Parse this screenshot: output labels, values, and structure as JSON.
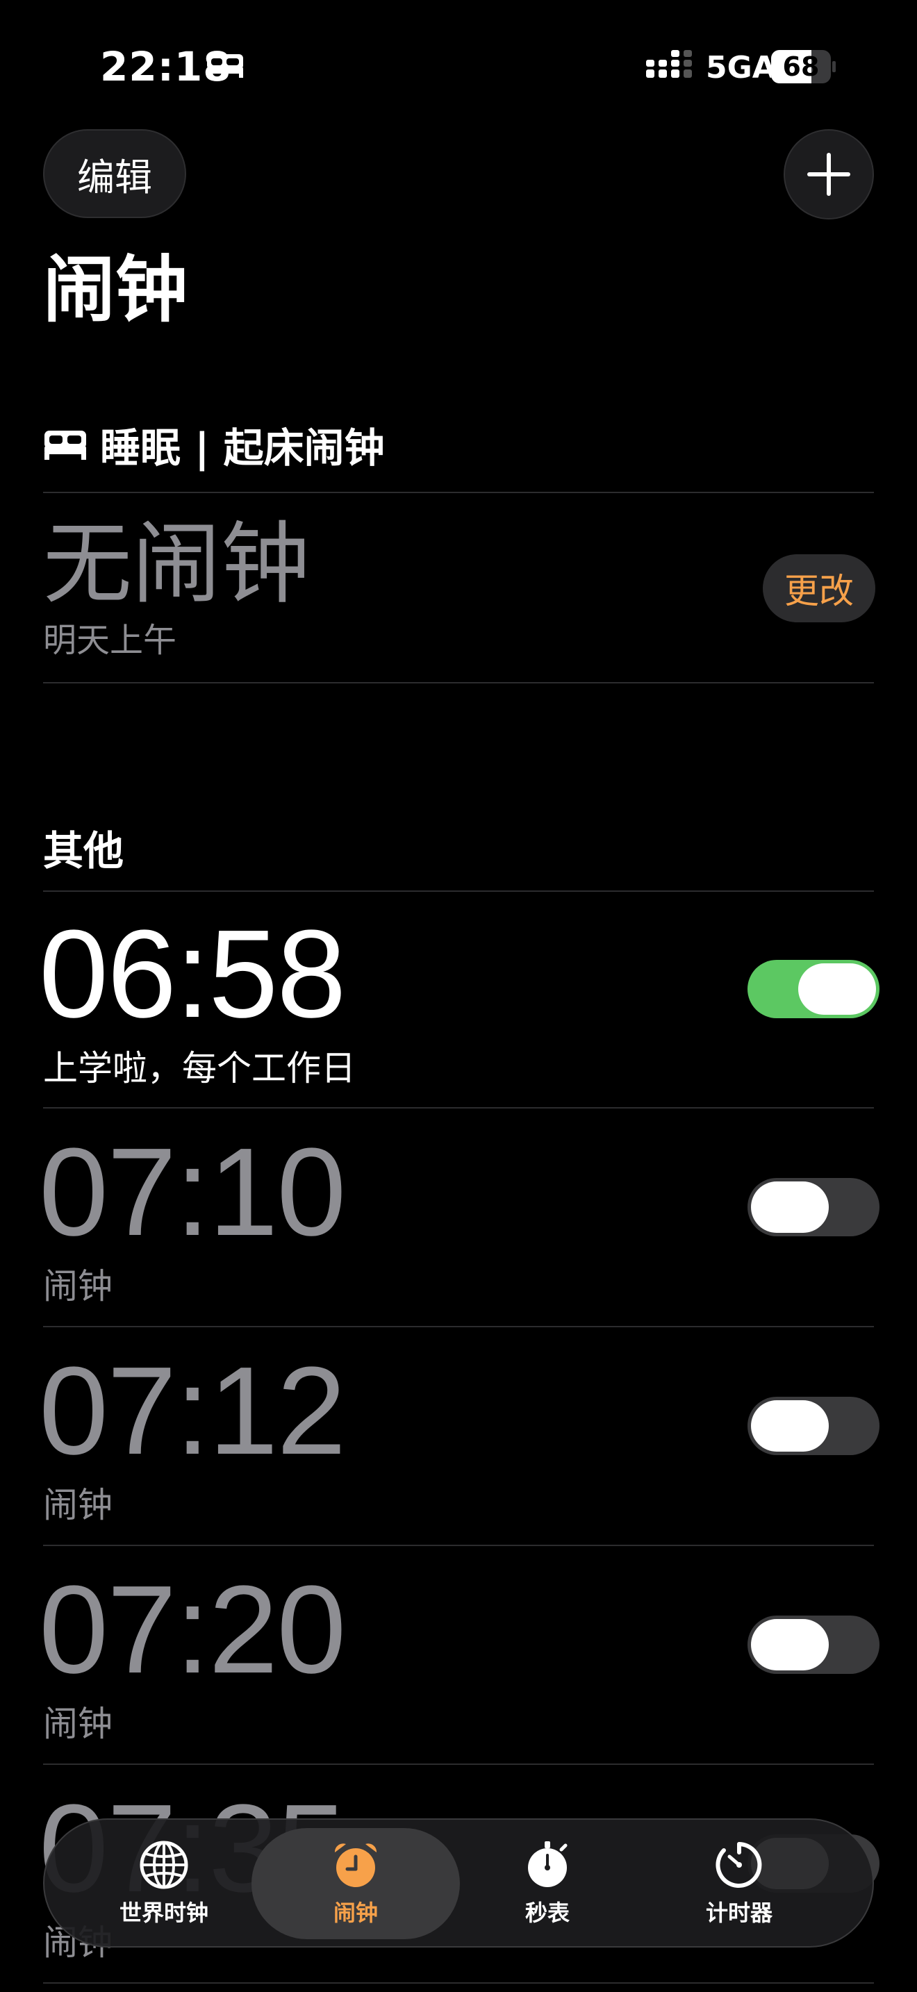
{
  "status_bar": {
    "time": "22:18",
    "network": "5GA",
    "battery_percent": 68,
    "battery_text": "68"
  },
  "header": {
    "edit_label": "编辑",
    "title": "闹钟"
  },
  "sleep": {
    "header": "睡眠 | 起床闹钟",
    "status": "无闹钟",
    "subtitle": "明天上午",
    "change_label": "更改"
  },
  "others": {
    "title": "其他",
    "alarms": [
      {
        "time": "06:58",
        "label": "上学啦，每个工作日",
        "enabled": true
      },
      {
        "time": "07:10",
        "label": "闹钟",
        "enabled": false
      },
      {
        "time": "07:12",
        "label": "闹钟",
        "enabled": false
      },
      {
        "time": "07:20",
        "label": "闹钟",
        "enabled": false
      },
      {
        "time": "07:35",
        "label": "闹钟",
        "enabled": false
      }
    ]
  },
  "tab_bar": {
    "tabs": [
      {
        "label": "世界时钟",
        "icon": "globe-icon"
      },
      {
        "label": "闹钟",
        "icon": "alarm-clock-icon",
        "active": true
      },
      {
        "label": "秒表",
        "icon": "stopwatch-icon"
      },
      {
        "label": "计时器",
        "icon": "timer-icon"
      }
    ]
  },
  "colors": {
    "accent": "#f7a14a",
    "toggle_on": "#5cc862",
    "toggle_off": "#3a3a3c",
    "secondary_text": "#8e8e93"
  }
}
